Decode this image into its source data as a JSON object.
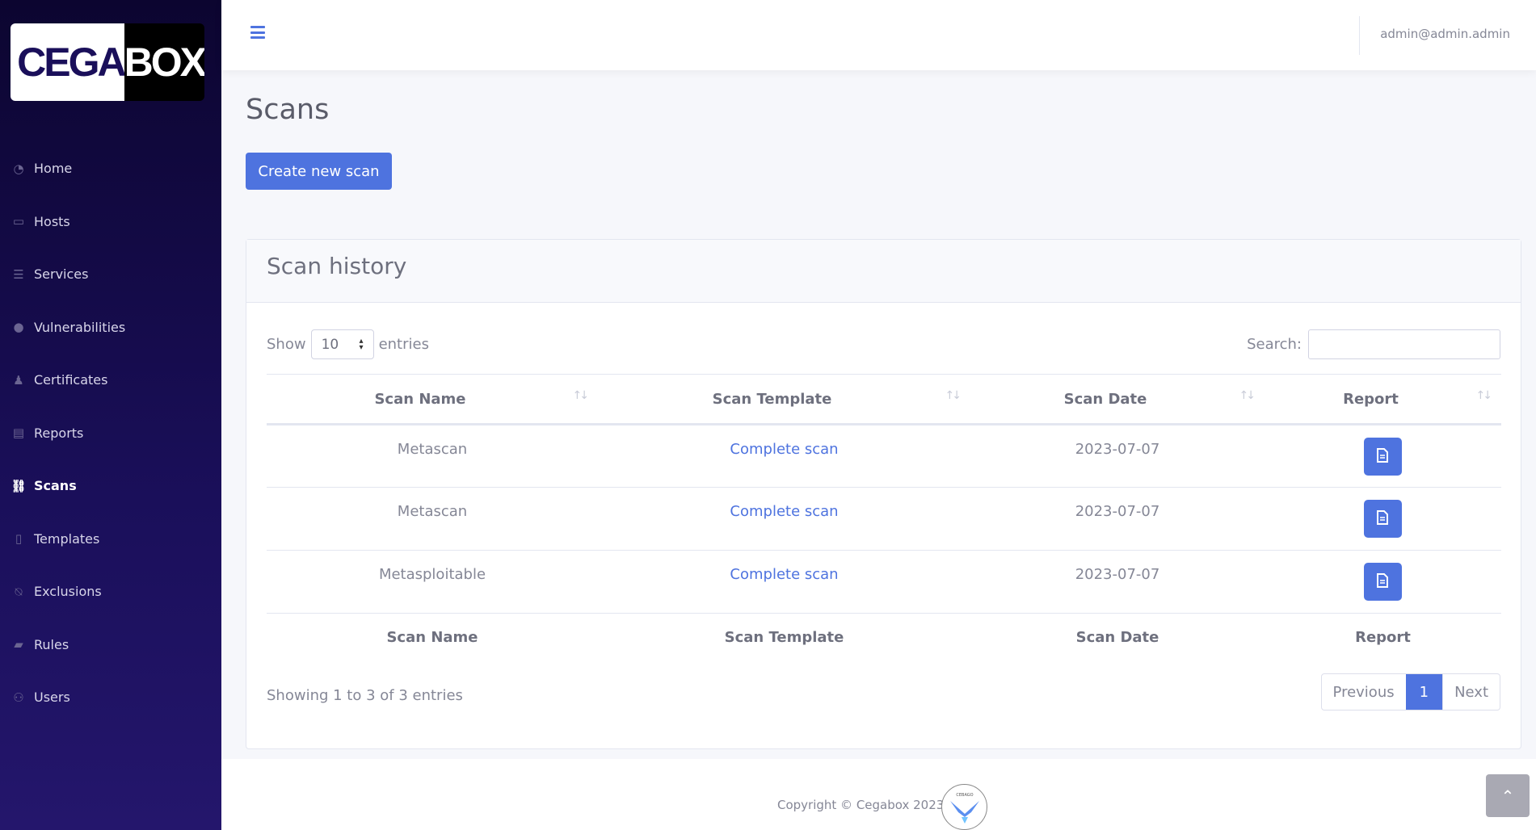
{
  "brand": {
    "logo_left": "CEGA",
    "logo_right": "BOX"
  },
  "sidebar": {
    "items": [
      {
        "label": "Home",
        "icon": "tachometer-icon"
      },
      {
        "label": "Hosts",
        "icon": "desktop-icon"
      },
      {
        "label": "Services",
        "icon": "server-icon"
      },
      {
        "label": "Vulnerabilities",
        "icon": "exclamation-circle-icon"
      },
      {
        "label": "Certificates",
        "icon": "stamp-icon"
      },
      {
        "label": "Reports",
        "icon": "file-report-icon"
      },
      {
        "label": "Scans",
        "icon": "binoculars-icon",
        "active": true
      },
      {
        "label": "Templates",
        "icon": "file-icon"
      },
      {
        "label": "Exclusions",
        "icon": "bell-slash-icon"
      },
      {
        "label": "Rules",
        "icon": "ruler-icon"
      },
      {
        "label": "Users",
        "icon": "users-icon"
      }
    ]
  },
  "topbar": {
    "user_email": "admin@admin.admin"
  },
  "page": {
    "title": "Scans",
    "create_button": "Create new scan"
  },
  "card": {
    "title": "Scan history",
    "show_label": "Show",
    "entries_value": "10",
    "entries_label": "entries",
    "search_label": "Search:",
    "search_value": "",
    "columns": [
      "Scan Name",
      "Scan Template",
      "Scan Date",
      "Report"
    ],
    "rows": [
      {
        "name": "Metascan",
        "template": "Complete scan",
        "date": "2023-07-07"
      },
      {
        "name": "Metascan",
        "template": "Complete scan",
        "date": "2023-07-07"
      },
      {
        "name": "Metasploitable",
        "template": "Complete scan",
        "date": "2023-07-07"
      }
    ],
    "info": "Showing 1 to 3 of 3 entries",
    "pagination": {
      "previous": "Previous",
      "current": "1",
      "next": "Next"
    }
  },
  "footer": {
    "copyright": "Copyright © Cegabox 2023",
    "logo_text": "CEBAGO"
  },
  "colors": {
    "primary": "#4e73df",
    "sidebar_top": "#0c0530",
    "sidebar_bottom": "#24166c"
  }
}
